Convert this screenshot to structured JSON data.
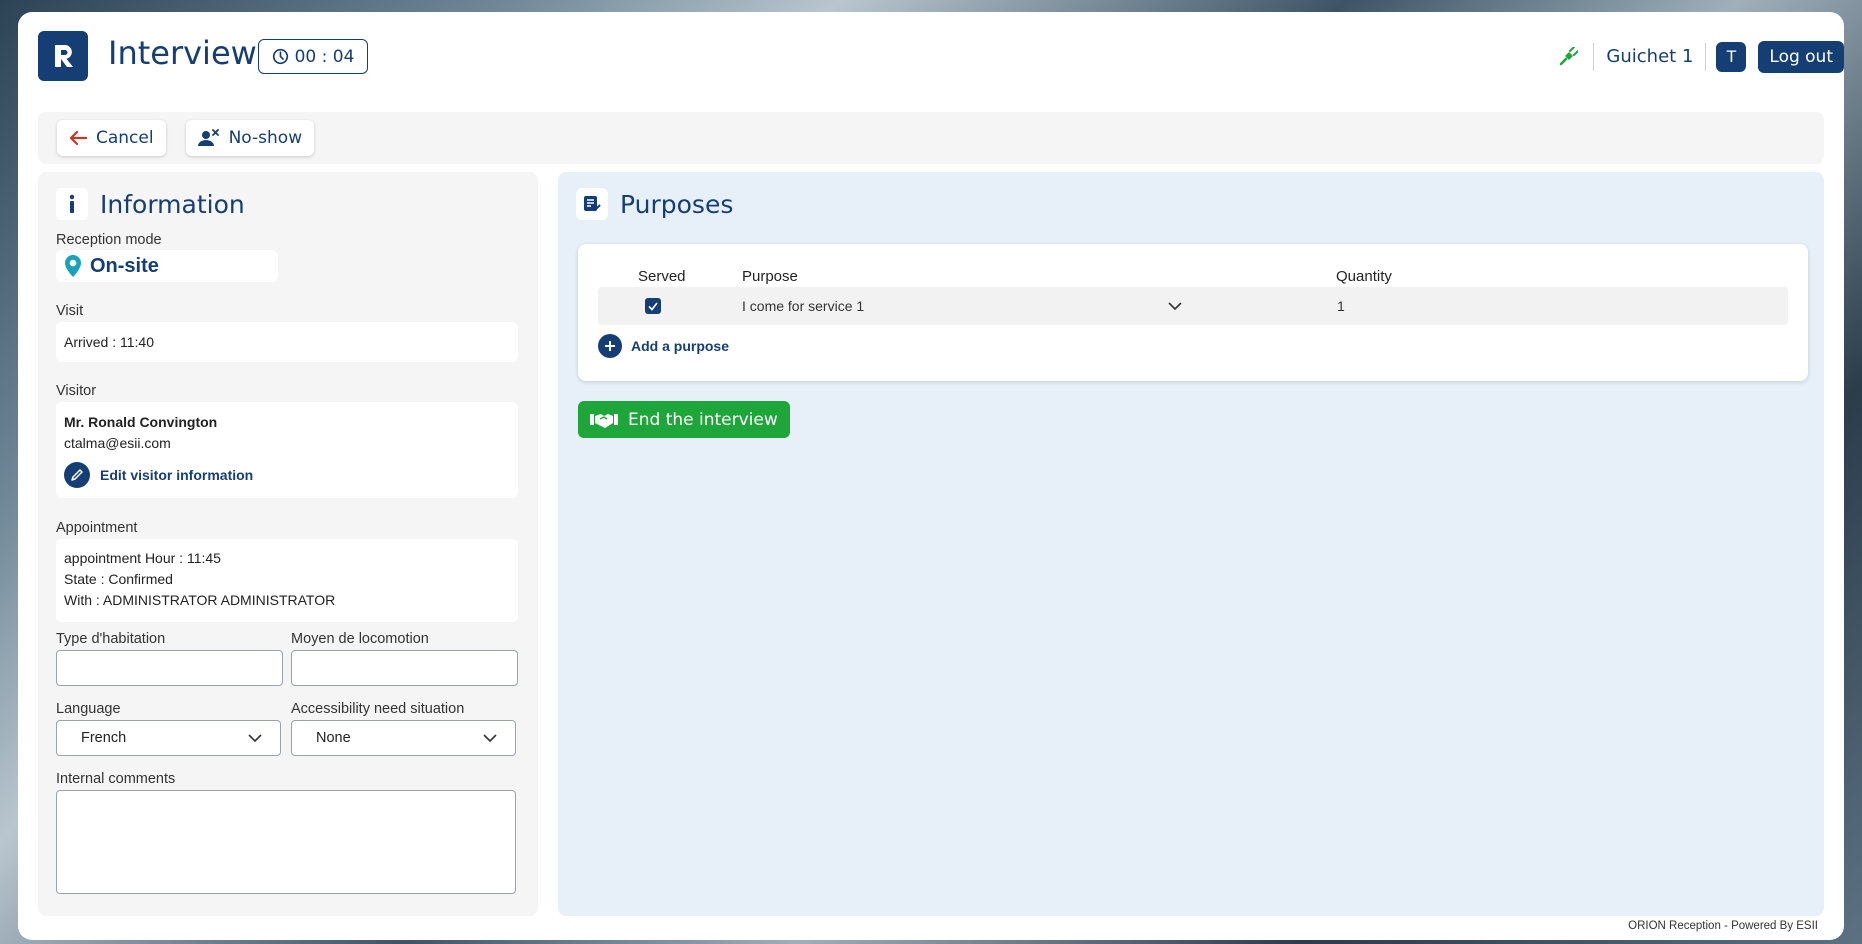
{
  "header": {
    "title": "Interview",
    "timer": "00 : 04",
    "counter": "Guichet 1",
    "avatar_letter": "T",
    "logout_label": "Log out"
  },
  "toolbar": {
    "cancel_label": "Cancel",
    "noshow_label": "No-show"
  },
  "info": {
    "title": "Information",
    "reception_mode_label": "Reception mode",
    "reception_mode_value": "On-site",
    "visit_label": "Visit",
    "arrived": "Arrived :  11:40",
    "visitor_label": "Visitor",
    "visitor_name": "Mr. Ronald Convington",
    "visitor_email": "ctalma@esii.com",
    "edit_visitor_label": "Edit visitor information",
    "appointment_label": "Appointment",
    "appointment_hour": "appointment Hour :  11:45",
    "appointment_state": "State :  Confirmed",
    "appointment_with": "With :  ADMINISTRATOR ADMINISTRATOR",
    "type_habitation_label": "Type d'habitation",
    "type_habitation_value": "",
    "locomotion_label": "Moyen de locomotion",
    "locomotion_value": "",
    "language_label": "Language",
    "language_value": "French",
    "accessibility_label": "Accessibility need situation",
    "accessibility_value": "None",
    "comments_label": "Internal comments",
    "comments_value": ""
  },
  "purposes": {
    "title": "Purposes",
    "columns": {
      "served": "Served",
      "purpose": "Purpose",
      "quantity": "Quantity"
    },
    "rows": [
      {
        "served": true,
        "purpose": "I come for service 1",
        "quantity": "1"
      }
    ],
    "add_label": "Add a purpose",
    "end_label": "End the interview"
  },
  "footer": "ORION Reception - Powered By ESII",
  "colors": {
    "primary": "#153e75",
    "success": "#1fa63b",
    "panel": "#f5f5f5",
    "purposes_bg": "#e7f0f9"
  }
}
